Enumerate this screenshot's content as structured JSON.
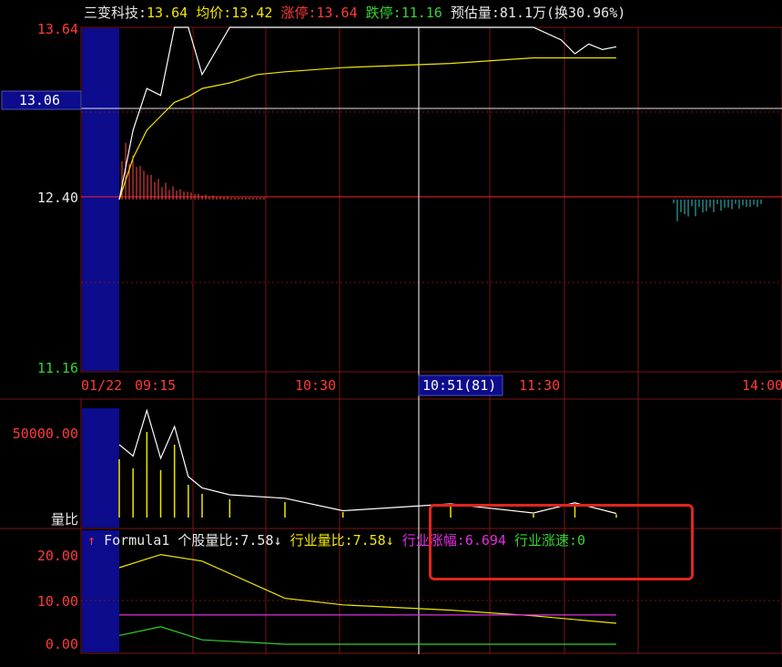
{
  "header": {
    "name_label": "三变科技:",
    "price": "13.64",
    "avg_label": "均价:",
    "avg": "13.42",
    "limit_up_label": "涨停:",
    "limit_up": "13.64",
    "limit_down_label": "跌停:",
    "limit_down": "11.16",
    "est_vol_label": "预估量:",
    "est_vol": "81.1万(换30.96%)"
  },
  "price_axis": {
    "labels": [
      "13.64",
      "13.06",
      "12.40",
      "11.16"
    ],
    "top": 13.64,
    "ref": 12.4,
    "bottom": 11.16,
    "cursor": 13.06
  },
  "time_axis": {
    "date_label": "01/22",
    "labels": [
      "09:15",
      "10:30",
      "11:30",
      "14:00"
    ],
    "cursor_label": "10:51(81)"
  },
  "volume_axis": {
    "label_top": "50000.00",
    "label_bottom": "量比"
  },
  "formula": {
    "arrow_up": "↑",
    "name": "Formula1",
    "stock_ratio_label": "个股量比:",
    "stock_ratio": "7.58",
    "arrow_down_1": "↓",
    "industry_ratio_label": "行业量比:",
    "industry_ratio": "7.58",
    "arrow_down_2": "↓",
    "industry_change_label": "行业涨幅:",
    "industry_change": "6.694",
    "industry_speed_label": "行业涨速:",
    "industry_speed": "0",
    "axis_labels": [
      "20.00",
      "10.00",
      "0.00"
    ]
  },
  "colors": {
    "price_line": "#ffffff",
    "avg_line": "#f2e600",
    "up_bar": "#ff4a4a",
    "down_bar": "#39c6c6",
    "volume_bar": "#f2e600",
    "auction_block": "#0c0c8c",
    "grid": "#7a1515",
    "magenta_line": "#e030e0",
    "green_line": "#30d030"
  },
  "chart_data": [
    {
      "type": "line",
      "title": "三变科技",
      "x_unit": "time",
      "x": [
        "09:30",
        "09:35",
        "09:40",
        "09:45",
        "09:50",
        "09:55",
        "10:00",
        "10:10",
        "10:20",
        "10:30",
        "10:51",
        "11:30",
        "13:30",
        "13:40",
        "13:45",
        "13:50",
        "13:55",
        "14:00"
      ],
      "series": [
        {
          "values": [
            12.4,
            12.9,
            13.2,
            13.15,
            13.64,
            13.64,
            13.3,
            13.64,
            13.64,
            13.64,
            13.64,
            13.64,
            13.64,
            13.55,
            13.45,
            13.52,
            13.48,
            13.5
          ]
        },
        {
          "values": [
            12.4,
            12.7,
            12.9,
            13.0,
            13.1,
            13.14,
            13.2,
            13.24,
            13.3,
            13.32,
            13.35,
            13.38,
            13.42,
            13.42,
            13.42,
            13.42,
            13.42,
            13.42
          ]
        }
      ],
      "ylim": [
        11.16,
        13.64
      ]
    },
    {
      "type": "bar",
      "x_unit": "time",
      "categories": [
        "09:30",
        "09:35",
        "09:40",
        "09:45",
        "09:50",
        "09:55",
        "10:00",
        "10:10",
        "10:30",
        "10:51",
        "11:30",
        "13:30",
        "13:45",
        "14:00"
      ],
      "values": [
        32000,
        27000,
        47000,
        26000,
        40000,
        18000,
        13000,
        10000,
        8500,
        3000,
        6000,
        2000,
        6500,
        1800
      ],
      "ylabel": "量比",
      "ylim": [
        0,
        60000
      ]
    },
    {
      "type": "line",
      "title": "Formula1",
      "x_unit": "time",
      "x": [
        "09:30",
        "09:45",
        "10:00",
        "10:30",
        "10:51",
        "11:30",
        "13:30",
        "14:00"
      ],
      "series": [
        {
          "name": "个股量比",
          "values": [
            17.5,
            20.5,
            19.0,
            10.5,
            9.0,
            7.8,
            6.5,
            4.8
          ]
        },
        {
          "name": "行业量比",
          "values": [
            17.5,
            20.5,
            19.0,
            10.5,
            9.0,
            7.8,
            6.5,
            4.8
          ]
        },
        {
          "name": "行业涨幅",
          "values": [
            6.694,
            6.694,
            6.694,
            6.694,
            6.694,
            6.694,
            6.694,
            6.694
          ]
        },
        {
          "name": "行业涨速",
          "values": [
            2.0,
            4.0,
            1.0,
            0.0,
            0.0,
            0.0,
            0.0,
            0.0
          ]
        }
      ],
      "ylim": [
        -1,
        25
      ]
    }
  ]
}
